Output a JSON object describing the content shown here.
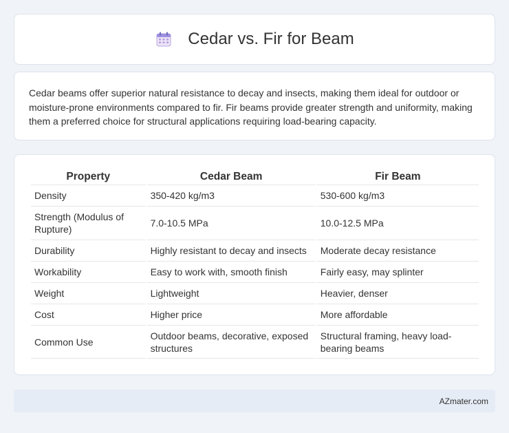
{
  "header": {
    "title": "Cedar vs. Fir for Beam",
    "icon": "calendar-icon"
  },
  "intro": {
    "text": "Cedar beams offer superior natural resistance to decay and insects, making them ideal for outdoor or moisture-prone environments compared to fir. Fir beams provide greater strength and uniformity, making them a preferred choice for structural applications requiring load-bearing capacity."
  },
  "table": {
    "headers": [
      "Property",
      "Cedar Beam",
      "Fir Beam"
    ],
    "rows": [
      [
        "Density",
        "350-420 kg/m3",
        "530-600 kg/m3"
      ],
      [
        "Strength (Modulus of Rupture)",
        "7.0-10.5 MPa",
        "10.0-12.5 MPa"
      ],
      [
        "Durability",
        "Highly resistant to decay and insects",
        "Moderate decay resistance"
      ],
      [
        "Workability",
        "Easy to work with, smooth finish",
        "Fairly easy, may splinter"
      ],
      [
        "Weight",
        "Lightweight",
        "Heavier, denser"
      ],
      [
        "Cost",
        "Higher price",
        "More affordable"
      ],
      [
        "Common Use",
        "Outdoor beams, decorative, exposed structures",
        "Structural framing, heavy load-bearing beams"
      ]
    ]
  },
  "footer": {
    "brand": "AZmater.com"
  }
}
